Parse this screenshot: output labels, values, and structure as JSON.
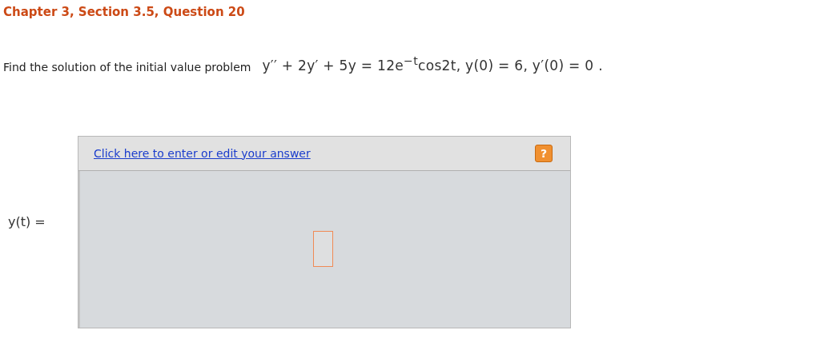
{
  "title": "Chapter 3, Section 3.5, Question 20",
  "question": {
    "text": "Find the solution of the initial value problem",
    "equation": "y′′ + 2y′ + 5y = 12e$^{−t}$cos2t,  y(0) = 6,  y′(0) = 0 ."
  },
  "answer": {
    "label": "y(t) =",
    "link": "Click here to enter or edit your answer",
    "help": "?"
  }
}
